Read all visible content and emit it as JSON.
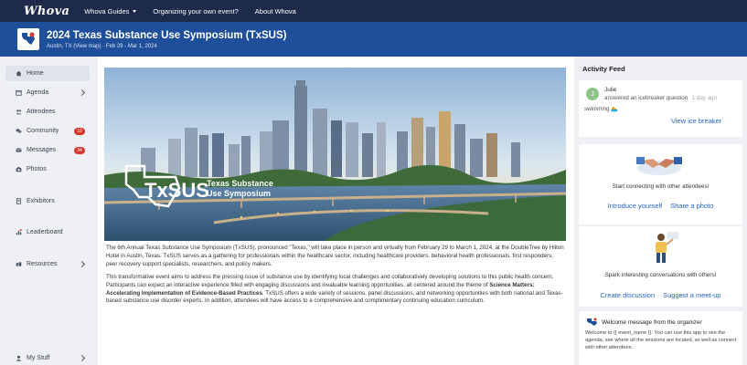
{
  "topnav": {
    "logo": "Whova",
    "links": [
      "Whova Guides",
      "Organizing your own event?",
      "About Whova"
    ]
  },
  "event": {
    "title": "2024 Texas Substance Use Symposium (TxSUS)",
    "location": "Austin, TX",
    "map_link": "(View map)",
    "dates": "Feb 29 - Mar 1, 2024"
  },
  "sidebar": {
    "items": [
      {
        "label": "Home",
        "icon": "home-icon"
      },
      {
        "label": "Agenda",
        "icon": "agenda-icon"
      },
      {
        "label": "Attendees",
        "icon": "attendees-icon"
      },
      {
        "label": "Community",
        "icon": "community-icon",
        "badge": "10"
      },
      {
        "label": "Messages",
        "icon": "messages-icon",
        "badge": "34"
      },
      {
        "label": "Photos",
        "icon": "photos-icon"
      },
      {
        "label": "Exhibitors",
        "icon": "exhibitors-icon"
      },
      {
        "label": "Leaderboard",
        "icon": "leaderboard-icon"
      },
      {
        "label": "Resources",
        "icon": "resources-icon"
      },
      {
        "label": "My Stuff",
        "icon": "my-stuff-icon"
      }
    ]
  },
  "hero": {
    "logo_text": "TxSUS",
    "logo_line1": "Texas Substance",
    "logo_line2": "Use Symposium"
  },
  "description": {
    "p1": "The 6th Annual Texas Substance Use Symposium (TxSUS), pronounced \"Texas,\" will take place in person and virtually from February 29 to March 1, 2024, at the DoubleTree by Hilton Hotel in Austin, Texas. TxSUS serves as a gathering for professionals within the healthcare sector, including healthcare providers, behavioral health professionals, first responders, peer recovery support specialists, researchers, and policy makers.",
    "p2a": "This transformative event aims to address the pressing issue of substance use by identifying local challenges and collaboratively developing solutions to this public health concern. Participants can expect an interactive experience filled with engaging discussions and invaluable learning opportunities, all centered around the theme of ",
    "p2b": "Science Matters: Accelerating Implementation of Evidence-Based Practices",
    "p2c": ". TxSUS offers a wide variety of sessions, panel discussions, and networking opportunities with both national and Texas-based substance use disorder experts. In addition, attendees will have access to a comprehensive and complimentary continuing education curriculum."
  },
  "feed": {
    "title": "Activity Feed",
    "icebreaker": {
      "avatar": "J",
      "name": "Julie",
      "action": "answered an icebreaker question",
      "time": "1 day ago",
      "answer": "swimming",
      "link": "View ice breaker"
    },
    "connect": {
      "title": "Start connecting with other attendees!",
      "link1": "Introduce yourself",
      "link2": "Share a photo"
    },
    "spark": {
      "title": "Spark interesting conversations with others!",
      "link1": "Create discussion",
      "link2": "Suggest a meet-up"
    },
    "welcome": {
      "title": "Welcome message from the organizer",
      "body": "Welcome to {{ event_name }}. You can use this app to see the agenda, see where all the sessions are located, as well as connect with other attendees."
    }
  },
  "colors": {
    "topnav": "#1d2a4a",
    "event_header": "#1f4e9a",
    "link": "#2563c9",
    "badge": "#d9362b"
  }
}
